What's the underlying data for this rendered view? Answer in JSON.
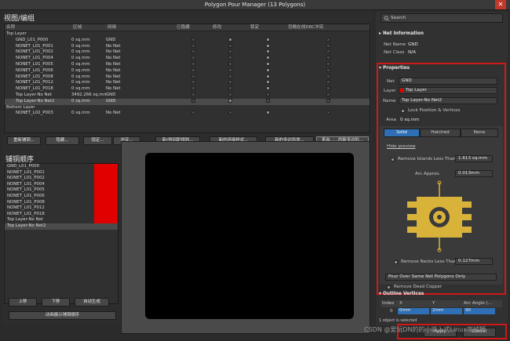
{
  "window": {
    "title": "Polygon Pour Manager (13 Polygons)",
    "close_glyph": "✕"
  },
  "left": {
    "view_header": "视图/编组",
    "columns": [
      "名称",
      "区域",
      "网络",
      "已隐藏",
      "修改",
      "锁定",
      "忽略在线DRC冲突"
    ],
    "groups": [
      {
        "name": "Top Layer",
        "rows": [
          {
            "name": "GND_L01_P000",
            "area": "0 sq.mm",
            "net": "GND",
            "hidden": false,
            "modified": true,
            "locked": true
          },
          {
            "name": "NONET_L01_P001",
            "area": "0 sq.mm",
            "net": "No Net",
            "hidden": false,
            "modified": false,
            "locked": true
          },
          {
            "name": "NONET_L01_P002",
            "area": "0 sq.mm",
            "net": "No Net",
            "hidden": false,
            "modified": false,
            "locked": true
          },
          {
            "name": "NONET_L01_P004",
            "area": "0 sq.mm",
            "net": "No Net",
            "hidden": false,
            "modified": false,
            "locked": true
          },
          {
            "name": "NONET_L01_P005",
            "area": "0 sq.mm",
            "net": "No Net",
            "hidden": false,
            "modified": false,
            "locked": true
          },
          {
            "name": "NONET_L01_P006",
            "area": "0 sq.mm",
            "net": "No Net",
            "hidden": false,
            "modified": false,
            "locked": true
          },
          {
            "name": "NONET_L01_P008",
            "area": "0 sq.mm",
            "net": "No Net",
            "hidden": false,
            "modified": false,
            "locked": true
          },
          {
            "name": "NONET_L01_P012",
            "area": "0 sq.mm",
            "net": "No Net",
            "hidden": false,
            "modified": false,
            "locked": true
          },
          {
            "name": "NONET_L01_P018",
            "area": "0 sq.mm",
            "net": "No Net",
            "hidden": false,
            "modified": false,
            "locked": true
          },
          {
            "name": "Top Layer-No Net",
            "area": "3492.266 sq.mm",
            "net": "GND",
            "hidden": false,
            "modified": false,
            "locked": false
          },
          {
            "name": "Top Layer-No Net2",
            "area": "0 sq.mm",
            "net": "GND",
            "hidden": false,
            "modified": true,
            "locked": false,
            "selected": true
          }
        ]
      },
      {
        "name": "Bottom Layer",
        "rows": [
          {
            "name": "NONET_L02_P003",
            "area": "0 sq.mm",
            "net": "No Net",
            "hidden": false,
            "modified": false,
            "locked": true
          }
        ]
      }
    ],
    "buttons": [
      "重新铺铜...",
      "隐藏...",
      "锁定...",
      "冲突...",
      "新(得间距规则...",
      "新的连接样式...",
      "新的多边形类...",
      "来自......的新多边形..."
    ],
    "order_header": "铺铜顺序",
    "order_rows": [
      {
        "name": "GND_L01_P000",
        "bar": true
      },
      {
        "name": "NONET_L01_P001",
        "bar": true
      },
      {
        "name": "NONET_L01_P002",
        "bar": true
      },
      {
        "name": "NONET_L01_P004",
        "bar": true
      },
      {
        "name": "NONET_L01_P005",
        "bar": true
      },
      {
        "name": "NONET_L01_P006",
        "bar": true
      },
      {
        "name": "NONET_L01_P008",
        "bar": true
      },
      {
        "name": "NONET_L01_P012",
        "bar": true
      },
      {
        "name": "NONET_L01_P018",
        "bar": true
      },
      {
        "name": "Top Layer-No Net",
        "bar": true
      },
      {
        "name": "Top Layer-No Net2",
        "bar": false,
        "selected": true
      }
    ],
    "order_buttons": {
      "up": "上移",
      "down": "下移",
      "auto": "自动生成",
      "animate": "动画展示铺铜顺序"
    },
    "colors": {
      "order_bar": "#e00000",
      "preview_bg": "#000000"
    }
  },
  "right": {
    "search_placeholder": "Search",
    "net_info": {
      "header": "Net Information",
      "net_name_label": "Net Name",
      "net_name": "GND",
      "net_class_label": "Net Class",
      "net_class": "N/A"
    },
    "properties": {
      "header": "Properties",
      "net_label": "Net",
      "net_value": "GND",
      "layer_label": "Layer",
      "layer_value": "Top Layer",
      "layer_color": "#e00000",
      "name_label": "Name",
      "name_value": "Top Layer-No Net2",
      "lock_label": "Lock Position & Vertices",
      "area_label": "Area",
      "area_value": "0 sq.mm",
      "fill_modes": [
        "Solid",
        "Hatched",
        "None"
      ],
      "fill_selected": "Solid",
      "hide_preview": "Hide preview",
      "islands_label": "Remove Islands Less Than",
      "islands_value": "1.613 sq.mm",
      "arc_label": "Arc Approx.",
      "arc_value": "0.013mm",
      "necks_label": "Remove Necks Less Than",
      "necks_value": "0.127mm",
      "pour_over": "Pour Over Same Net Polygons Only",
      "dead_copper": "Remove Dead Copper",
      "accent": "#d9b23a"
    },
    "outline": {
      "header": "Outline Vertices",
      "columns": [
        "Index",
        "X",
        "Y",
        "Arc Angle (..."
      ],
      "row": {
        "index": "0",
        "x": "0mm",
        "y": "2mm",
        "angle": "90"
      }
    },
    "footer": {
      "selection": "1 object is selected",
      "apply": "Apply",
      "cancel": "Cancel"
    }
  },
  "watermark": "CSDN @爱玩DN的的小嵌入式Linux攻城狮"
}
